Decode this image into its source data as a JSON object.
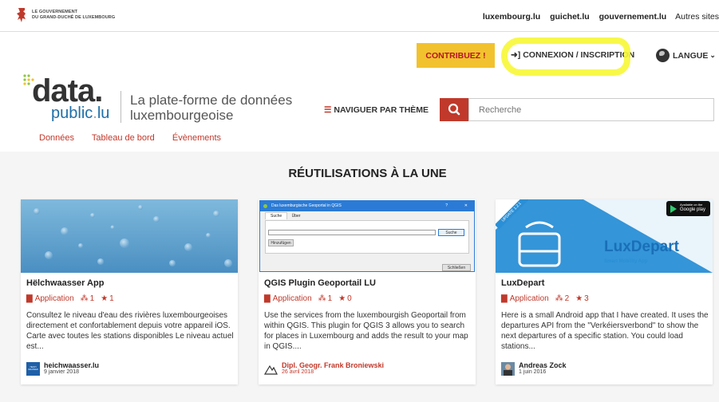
{
  "gov": {
    "line1": "LE GOUVERNEMENT",
    "line2": "DU GRAND-DUCHÉ DE LUXEMBOURG"
  },
  "toplinks": [
    "luxembourg.lu",
    "guichet.lu",
    "gouvernement.lu",
    "Autres sites"
  ],
  "header": {
    "contrib": "CONTRIBUEZ !",
    "login": "CONNEXION / INSCRIPTION",
    "langue": "LANGUE",
    "naviguer": "NAVIGUER PAR THÈME",
    "search_placeholder": "Recherche"
  },
  "logo": {
    "word": "data.",
    "sub_main": "public",
    "sub_dot": ".",
    "sub_tld": "lu",
    "tagline1": "La plate-forme de données",
    "tagline2": "luxembourgeoise"
  },
  "nav": [
    "Données",
    "Tableau de bord",
    "Évènements"
  ],
  "section_title": "RÉUTILISATIONS À LA UNE",
  "colors": {
    "accent": "#c0392b",
    "contrib_bg": "#f2c12e",
    "highlight": "#f7f736",
    "link_blue": "#1e6fa8"
  },
  "cards": [
    {
      "title": "Hëlchwaasser App",
      "type": "Application",
      "reuses": "1",
      "stars": "1",
      "desc": "Consultez le niveau d'eau des rivières luxembourgeoises directement et confortablement depuis votre appareil iOS. Carte avec toutes les stations disponibles Le niveau actuel est...",
      "author": "heichwaasser.lu",
      "date": "9 janvier 2018",
      "avatar_text": "HEICH WAASSER"
    },
    {
      "title": "QGIS Plugin Geoportail LU",
      "type": "Application",
      "reuses": "1",
      "stars": "0",
      "desc": "Use the services from the luxembourgish Geoportail from within QGIS. This plugin for QGIS 3 allows you to search for places in Luxembourg and adds the result to your map in QGIS....",
      "author": "Dipl. Geogr. Frank Broniewski",
      "date": "26 avril 2018",
      "dialog": {
        "title": "Das luxemburgische Geoportal in QGIS",
        "tab1": "Suche",
        "tab2": "Über",
        "search_btn": "Suche",
        "add_btn": "Hinzufügen",
        "close_btn": "Schließen",
        "help": "?",
        "close_x": "✕"
      }
    },
    {
      "title": "LuxDepart",
      "type": "Application",
      "reuses": "2",
      "stars": "3",
      "desc": "Here is a small Android app that I have created. It uses the departures API from the \"Verkéiersverbond\" to show the next departures of a specific station. You could load stations...",
      "author": "Andreas Zock",
      "date": "1 juin 2016",
      "banner": {
        "ribbon": "UPDATE 1.2.1",
        "brand": "LuxDepart",
        "tagline": "Smart Mobility App",
        "gp_small": "Available on the",
        "gp_big": "Google play"
      }
    }
  ]
}
